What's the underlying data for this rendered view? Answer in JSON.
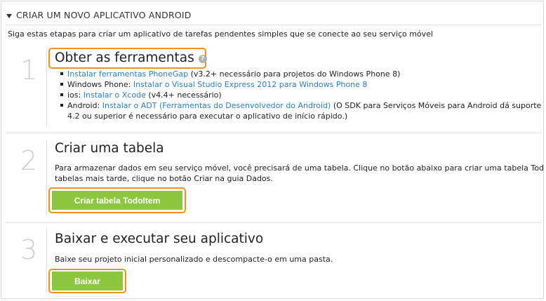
{
  "header": {
    "title": "CRIAR UM NOVO APLICATIVO ANDROID"
  },
  "intro": "Siga estas etapas para criar um aplicativo de tarefas pendentes simples que se conecte ao seu serviço móvel",
  "steps": [
    {
      "number": "1",
      "title": "Obter as ferramentas",
      "items": [
        {
          "prefix": "",
          "link": "Instalar ferramentas PhoneGap",
          "suffix": " (v3.2+ necessário para projetos do Windows Phone 8)"
        },
        {
          "prefix": "Windows Phone: ",
          "link": "Instalar o Visual Studio Express 2012 para Windows Phone 8",
          "suffix": ""
        },
        {
          "prefix": "ios: ",
          "link": "Instalar o Xcode",
          "suffix": " (v4.4+ necessário)"
        },
        {
          "prefix": "Android: ",
          "link": "Instalar o ADT (Ferramentas do Desenvolvedor do Android)",
          "suffix": " (O SDK para Serviços Móveis para Android dá suporte a ap..."
        }
      ],
      "continuation": "4.2 ou superior é necessário para executar o aplicativo de início rápido.)"
    },
    {
      "number": "2",
      "title": "Criar uma tabela",
      "description_line1": "Para armazenar dados em seu serviço móvel, você precisará de uma tabela. Clique no botão abaixo para criar uma tabela TodoItem...",
      "description_line2": "tabelas mais tarde, clique no botão Criar na guia Dados.",
      "button": "Criar tabela TodoItem"
    },
    {
      "number": "3",
      "title": "Baixar e executar seu aplicativo",
      "description": "Baixe seu projeto inicial personalizado e descompacte-o em uma pasta.",
      "button": "Baixar"
    }
  ],
  "colors": {
    "accent_button": "#8dc63f",
    "highlight": "#f0921e",
    "link": "#2b7fc4"
  }
}
